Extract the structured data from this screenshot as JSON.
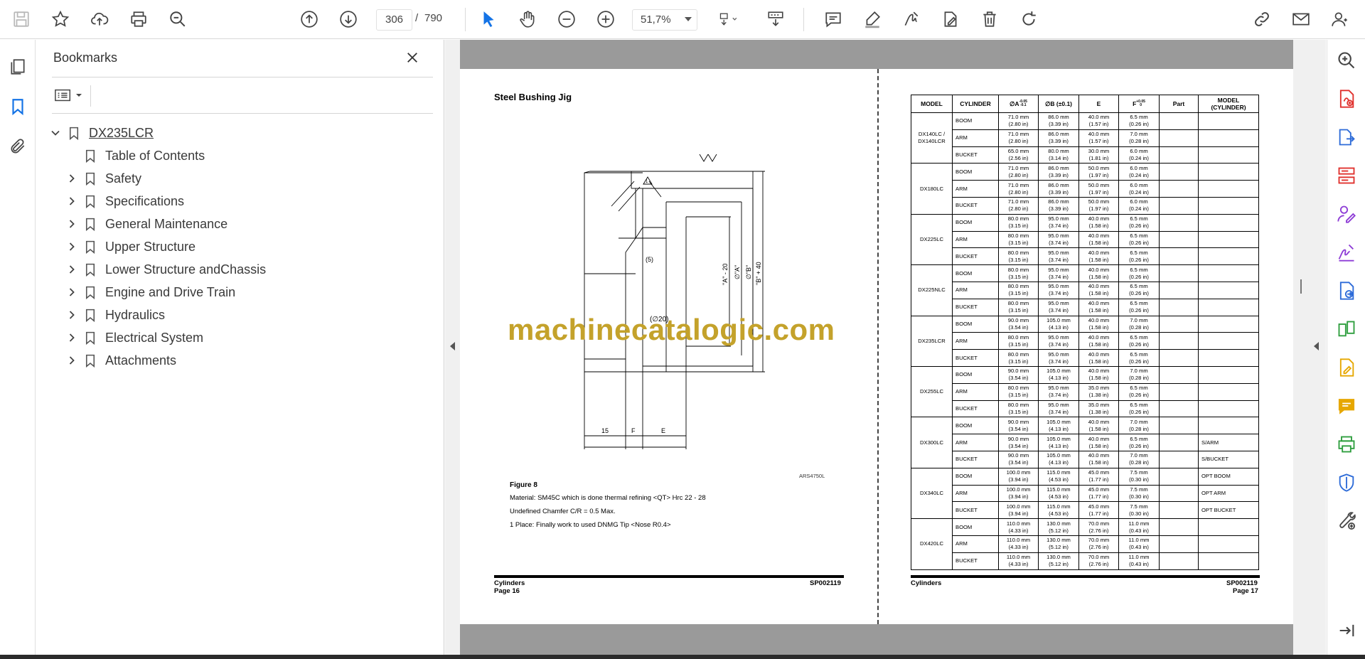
{
  "toolbar": {
    "current_page": "306",
    "page_separator": "/",
    "total_pages": "790",
    "zoom": "51,7%",
    "icons": [
      "save-icon",
      "bookmark-star-icon",
      "upload-cloud-icon",
      "print-icon",
      "zoom-search-icon",
      "page-up-icon",
      "page-down-icon",
      "select-cursor-icon",
      "hand-pan-icon",
      "zoom-out-icon",
      "zoom-in-icon",
      "fit-page-icon",
      "scroll-mode-icon",
      "comment-icon",
      "highlight-pen-icon",
      "sign-icon",
      "edit-pdf-icon",
      "delete-icon",
      "rotate-icon",
      "share-link-icon",
      "email-icon",
      "account-icon"
    ],
    "accent": "#1473e6"
  },
  "left_rail": {
    "icons": [
      "page-thumbnails-icon",
      "bookmarks-icon",
      "attachments-icon"
    ]
  },
  "bookmarks": {
    "title": "Bookmarks",
    "root": "DX235LCR",
    "items": [
      {
        "label": "Table of Contents",
        "expandable": false
      },
      {
        "label": "Safety",
        "expandable": true
      },
      {
        "label": "Specifications",
        "expandable": true
      },
      {
        "label": "General Maintenance",
        "expandable": true
      },
      {
        "label": "Upper Structure",
        "expandable": true
      },
      {
        "label": "Lower Structure andChassis",
        "expandable": true
      },
      {
        "label": "Engine and Drive Train",
        "expandable": true
      },
      {
        "label": "Hydraulics",
        "expandable": true
      },
      {
        "label": "Electrical System",
        "expandable": true
      },
      {
        "label": "Attachments",
        "expandable": true
      }
    ]
  },
  "document": {
    "left_page": {
      "heading": "Steel Bushing Jig",
      "drawing_labels": {
        "chamfer_note": "(5)",
        "bore": "(∅20)",
        "dim_a_minus": "\"A\" - 20",
        "dim_a": "∅\"A\"",
        "dim_b": "∅\"B\"",
        "dim_b_plus": "\"B\" + 40",
        "dim_15": "15",
        "dim_f": "F",
        "dim_e": "E",
        "surface_mark": "▽▽",
        "warning_mark": "1"
      },
      "figure_ref": "ARS4750L",
      "figure_caption": "Figure 8",
      "notes": [
        "Material: SM45C which is done thermal refining <QT> Hrc 22 - 28",
        "Undefined Chamfer C/R = 0.5 Max.",
        "1   Place: Finally work to used DNMG Tip <Nose R0.4>"
      ],
      "footer_left_1": "Cylinders",
      "footer_left_2": "Page 16",
      "footer_right": "SP002119"
    },
    "watermark": "machinecatalogic.com",
    "right_page": {
      "headers": [
        "MODEL",
        "CYLINDER",
        "∅A-0.05/-0.10",
        "∅B (±0.1)",
        "E",
        "F+0.05/0",
        "Part",
        "MODEL (CYLINDER)"
      ],
      "header_display": {
        "model": "MODEL",
        "cylinder": "CYLINDER",
        "a": "∅A",
        "a_tol_top": "-0.05",
        "a_tol_bot": "-0.1",
        "b": "∅B (±0.1)",
        "e": "E",
        "f": "F",
        "f_tol_top": "+0.05",
        "f_tol_bot": "0",
        "part": "Part",
        "model_cyl_1": "MODEL",
        "model_cyl_2": "(CYLINDER)"
      },
      "groups": [
        {
          "model": "DX140LC / DX140LCR",
          "rows": [
            {
              "cyl": "BOOM",
              "a": [
                "71.0 mm",
                "(2.80 in)"
              ],
              "b": [
                "86.0 mm",
                "(3.39 in)"
              ],
              "e": [
                "40.0 mm",
                "(1.57 in)"
              ],
              "f": [
                "6.5 mm",
                "(0.26 in)"
              ],
              "part": "",
              "mc": ""
            },
            {
              "cyl": "ARM",
              "a": [
                "71.0 mm",
                "(2.80 in)"
              ],
              "b": [
                "86.0 mm",
                "(3.39 in)"
              ],
              "e": [
                "40.0 mm",
                "(1.57 in)"
              ],
              "f": [
                "7.0 mm",
                "(0.28 in)"
              ],
              "part": "",
              "mc": ""
            },
            {
              "cyl": "BUCKET",
              "a": [
                "65.0 mm",
                "(2.56 in)"
              ],
              "b": [
                "80.0 mm",
                "(3.14 in)"
              ],
              "e": [
                "30.0 mm",
                "(1.81 in)"
              ],
              "f": [
                "6.0 mm",
                "(0.24 in)"
              ],
              "part": "",
              "mc": ""
            }
          ]
        },
        {
          "model": "DX180LC",
          "rows": [
            {
              "cyl": "BOOM",
              "a": [
                "71.0 mm",
                "(2.80 in)"
              ],
              "b": [
                "86.0 mm",
                "(3.39 in)"
              ],
              "e": [
                "50.0 mm",
                "(1.97 in)"
              ],
              "f": [
                "6.0 mm",
                "(0.24 in)"
              ],
              "part": "",
              "mc": ""
            },
            {
              "cyl": "ARM",
              "a": [
                "71.0 mm",
                "(2.80 in)"
              ],
              "b": [
                "86.0 mm",
                "(3.39 in)"
              ],
              "e": [
                "50.0 mm",
                "(1.97 in)"
              ],
              "f": [
                "6.0 mm",
                "(0.24 in)"
              ],
              "part": "",
              "mc": ""
            },
            {
              "cyl": "BUCKET",
              "a": [
                "71.0 mm",
                "(2.80 in)"
              ],
              "b": [
                "86.0 mm",
                "(3.39 in)"
              ],
              "e": [
                "50.0 mm",
                "(1.97 in)"
              ],
              "f": [
                "6.0 mm",
                "(0.24 in)"
              ],
              "part": "",
              "mc": ""
            }
          ]
        },
        {
          "model": "DX225LC",
          "rows": [
            {
              "cyl": "BOOM",
              "a": [
                "80.0 mm",
                "(3.15 in)"
              ],
              "b": [
                "95.0 mm",
                "(3.74 in)"
              ],
              "e": [
                "40.0 mm",
                "(1.58 in)"
              ],
              "f": [
                "6.5 mm",
                "(0.26 in)"
              ],
              "part": "",
              "mc": ""
            },
            {
              "cyl": "ARM",
              "a": [
                "80.0 mm",
                "(3.15 in)"
              ],
              "b": [
                "95.0 mm",
                "(3.74 in)"
              ],
              "e": [
                "40.0 mm",
                "(1.58 in)"
              ],
              "f": [
                "6.5 mm",
                "(0.26 in)"
              ],
              "part": "",
              "mc": ""
            },
            {
              "cyl": "BUCKET",
              "a": [
                "80.0 mm",
                "(3.15 in)"
              ],
              "b": [
                "95.0 mm",
                "(3.74 in)"
              ],
              "e": [
                "40.0 mm",
                "(1.58 in)"
              ],
              "f": [
                "6.5 mm",
                "(0.26 in)"
              ],
              "part": "",
              "mc": ""
            }
          ]
        },
        {
          "model": "DX225NLC",
          "rows": [
            {
              "cyl": "BOOM",
              "a": [
                "80.0 mm",
                "(3.15 in)"
              ],
              "b": [
                "95.0 mm",
                "(3.74 in)"
              ],
              "e": [
                "40.0 mm",
                "(1.58 in)"
              ],
              "f": [
                "6.5 mm",
                "(0.26 in)"
              ],
              "part": "",
              "mc": ""
            },
            {
              "cyl": "ARM",
              "a": [
                "80.0 mm",
                "(3.15 in)"
              ],
              "b": [
                "95.0 mm",
                "(3.74 in)"
              ],
              "e": [
                "40.0 mm",
                "(1.58 in)"
              ],
              "f": [
                "6.5 mm",
                "(0.26 in)"
              ],
              "part": "",
              "mc": ""
            },
            {
              "cyl": "BUCKET",
              "a": [
                "80.0 mm",
                "(3.15 in)"
              ],
              "b": [
                "95.0 mm",
                "(3.74 in)"
              ],
              "e": [
                "40.0 mm",
                "(1.58 in)"
              ],
              "f": [
                "6.5 mm",
                "(0.26 in)"
              ],
              "part": "",
              "mc": ""
            }
          ]
        },
        {
          "model": "DX235LCR",
          "rows": [
            {
              "cyl": "BOOM",
              "a": [
                "90.0 mm",
                "(3.54 in)"
              ],
              "b": [
                "105.0 mm",
                "(4.13 in)"
              ],
              "e": [
                "40.0 mm",
                "(1.58 in)"
              ],
              "f": [
                "7.0 mm",
                "(0.28 in)"
              ],
              "part": "",
              "mc": ""
            },
            {
              "cyl": "ARM",
              "a": [
                "80.0 mm",
                "(3.15 in)"
              ],
              "b": [
                "95.0 mm",
                "(3.74 in)"
              ],
              "e": [
                "40.0 mm",
                "(1.58 in)"
              ],
              "f": [
                "6.5 mm",
                "(0.26 in)"
              ],
              "part": "",
              "mc": ""
            },
            {
              "cyl": "BUCKET",
              "a": [
                "80.0 mm",
                "(3.15 in)"
              ],
              "b": [
                "95.0 mm",
                "(3.74 in)"
              ],
              "e": [
                "40.0 mm",
                "(1.58 in)"
              ],
              "f": [
                "6.5 mm",
                "(0.26 in)"
              ],
              "part": "",
              "mc": ""
            }
          ]
        },
        {
          "model": "DX255LC",
          "rows": [
            {
              "cyl": "BOOM",
              "a": [
                "90.0 mm",
                "(3.54 in)"
              ],
              "b": [
                "105.0 mm",
                "(4.13 in)"
              ],
              "e": [
                "40.0 mm",
                "(1.58 in)"
              ],
              "f": [
                "7.0 mm",
                "(0.28 in)"
              ],
              "part": "",
              "mc": ""
            },
            {
              "cyl": "ARM",
              "a": [
                "80.0 mm",
                "(3.15 in)"
              ],
              "b": [
                "95.0 mm",
                "(3.74 in)"
              ],
              "e": [
                "35.0 mm",
                "(1.38 in)"
              ],
              "f": [
                "6.5 mm",
                "(0.26 in)"
              ],
              "part": "",
              "mc": ""
            },
            {
              "cyl": "BUCKET",
              "a": [
                "80.0 mm",
                "(3.15 in)"
              ],
              "b": [
                "95.0 mm",
                "(3.74 in)"
              ],
              "e": [
                "35.0 mm",
                "(1.38 in)"
              ],
              "f": [
                "6.5 mm",
                "(0.26 in)"
              ],
              "part": "",
              "mc": ""
            }
          ]
        },
        {
          "model": "DX300LC",
          "rows": [
            {
              "cyl": "BOOM",
              "a": [
                "90.0 mm",
                "(3.54 in)"
              ],
              "b": [
                "105.0 mm",
                "(4.13 in)"
              ],
              "e": [
                "40.0 mm",
                "(1.58 in)"
              ],
              "f": [
                "7.0 mm",
                "(0.28 in)"
              ],
              "part": "",
              "mc": ""
            },
            {
              "cyl": "ARM",
              "a": [
                "90.0 mm",
                "(3.54 in)"
              ],
              "b": [
                "105.0 mm",
                "(4.13 in)"
              ],
              "e": [
                "40.0 mm",
                "(1.58 in)"
              ],
              "f": [
                "6.5 mm",
                "(0.26 in)"
              ],
              "part": "",
              "mc": "S/ARM"
            },
            {
              "cyl": "BUCKET",
              "a": [
                "90.0 mm",
                "(3.54 in)"
              ],
              "b": [
                "105.0 mm",
                "(4.13 in)"
              ],
              "e": [
                "40.0 mm",
                "(1.58 in)"
              ],
              "f": [
                "7.0 mm",
                "(0.28 in)"
              ],
              "part": "",
              "mc": "S/BUCKET"
            }
          ]
        },
        {
          "model": "DX340LC",
          "rows": [
            {
              "cyl": "BOOM",
              "a": [
                "100.0 mm",
                "(3.94 in)"
              ],
              "b": [
                "115.0 mm",
                "(4.53 in)"
              ],
              "e": [
                "45.0 mm",
                "(1.77 in)"
              ],
              "f": [
                "7.5 mm",
                "(0.30 in)"
              ],
              "part": "",
              "mc": "OPT BOOM"
            },
            {
              "cyl": "ARM",
              "a": [
                "100.0 mm",
                "(3.94 in)"
              ],
              "b": [
                "115.0 mm",
                "(4.53 in)"
              ],
              "e": [
                "45.0 mm",
                "(1.77 in)"
              ],
              "f": [
                "7.5 mm",
                "(0.30 in)"
              ],
              "part": "",
              "mc": "OPT ARM"
            },
            {
              "cyl": "BUCKET",
              "a": [
                "100.0 mm",
                "(3.94 in)"
              ],
              "b": [
                "115.0 mm",
                "(4.53 in)"
              ],
              "e": [
                "45.0 mm",
                "(1.77 in)"
              ],
              "f": [
                "7.5 mm",
                "(0.30 in)"
              ],
              "part": "",
              "mc": "OPT BUCKET"
            }
          ]
        },
        {
          "model": "DX420LC",
          "rows": [
            {
              "cyl": "BOOM",
              "a": [
                "110.0 mm",
                "(4.33 in)"
              ],
              "b": [
                "130.0 mm",
                "(5.12 in)"
              ],
              "e": [
                "70.0 mm",
                "(2.76 in)"
              ],
              "f": [
                "11.0 mm",
                "(0.43 in)"
              ],
              "part": "",
              "mc": ""
            },
            {
              "cyl": "ARM",
              "a": [
                "110.0 mm",
                "(4.33 in)"
              ],
              "b": [
                "130.0 mm",
                "(5.12 in)"
              ],
              "e": [
                "70.0 mm",
                "(2.76 in)"
              ],
              "f": [
                "11.0 mm",
                "(0.43 in)"
              ],
              "part": "",
              "mc": ""
            },
            {
              "cyl": "BUCKET",
              "a": [
                "110.0 mm",
                "(4.33 in)"
              ],
              "b": [
                "130.0 mm",
                "(5.12 in)"
              ],
              "e": [
                "70.0 mm",
                "(2.76 in)"
              ],
              "f": [
                "11.0 mm",
                "(0.43 in)"
              ],
              "part": "",
              "mc": ""
            }
          ]
        }
      ],
      "footer_left": "Cylinders",
      "footer_right_1": "SP002119",
      "footer_right_2": "Page 17"
    }
  },
  "right_rail": {
    "icons": [
      "zoom-pages-icon",
      "create-pdf-icon",
      "export-pdf-icon",
      "organize-pages-icon",
      "fill-sign-icon",
      "request-signature-icon",
      "combine-files-icon",
      "compare-files-icon",
      "edit-pdf-icon",
      "comment-icon",
      "print-production-icon",
      "protect-icon",
      "more-tools-icon",
      "expand-panel-icon"
    ],
    "colors": {
      "red": "#e0312d",
      "blue": "#2d6bd8",
      "purple": "#8e3dd6",
      "teal": "#0e8f84",
      "yellow": "#e6a700",
      "green": "#2e9e3e",
      "gray": "#4a4a4a"
    }
  }
}
